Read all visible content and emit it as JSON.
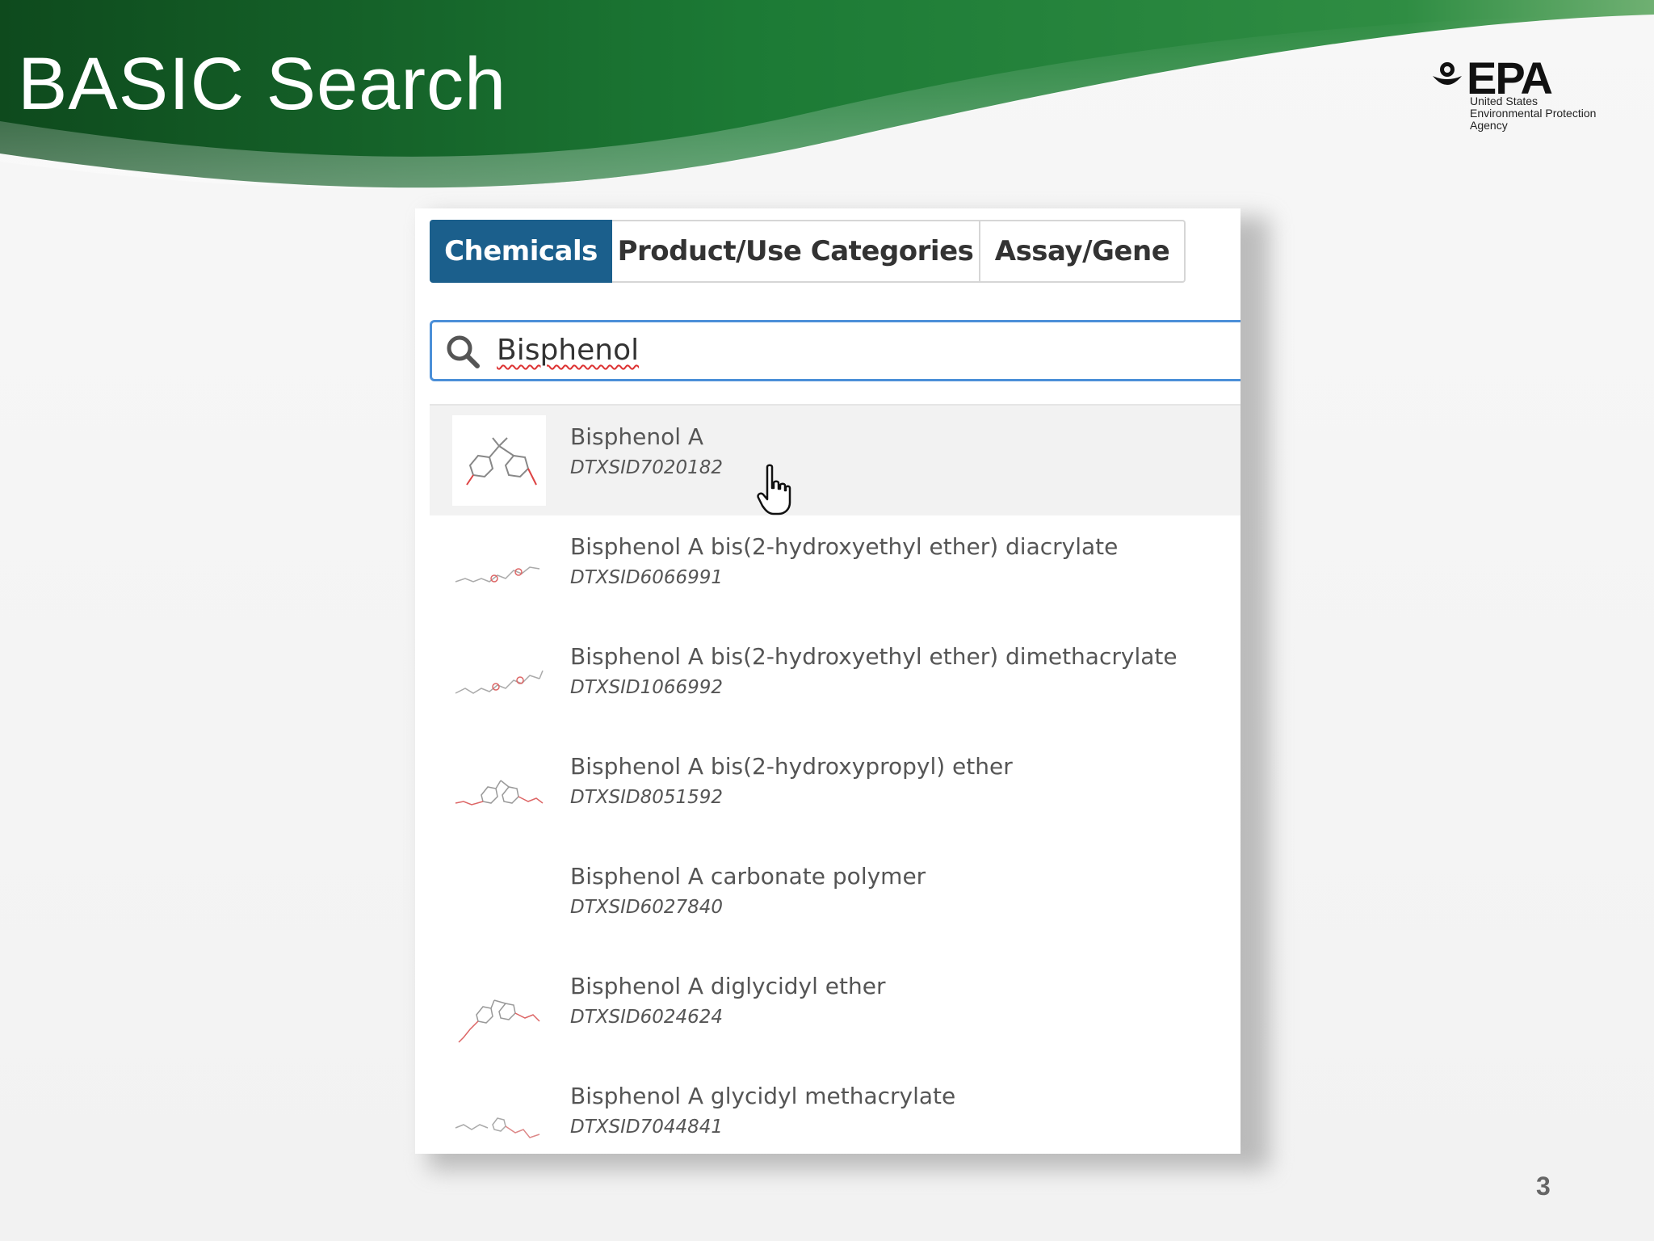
{
  "slide": {
    "title": "BASIC Search",
    "page_number": "3",
    "colors": {
      "banner_dark": "#0f4d1f",
      "banner_mid": "#1f7a36",
      "banner_light": "#5aa05f"
    }
  },
  "logo": {
    "wordmark": "EPA",
    "subtitle": "United States\nEnvironmental Protection\nAgency"
  },
  "tabs": [
    {
      "label": "Chemicals",
      "active": true
    },
    {
      "label": "Product/Use Categories",
      "active": false
    },
    {
      "label": "Assay/Gene",
      "active": false
    }
  ],
  "search": {
    "value": "Bisphenol",
    "icon": "search-icon",
    "accent": "#4b8fd8"
  },
  "results": [
    {
      "name": "Bisphenol A",
      "id": "DTXSID7020182",
      "hover": true
    },
    {
      "name": "Bisphenol A bis(2-hydroxyethyl ether) diacrylate",
      "id": "DTXSID6066991"
    },
    {
      "name": "Bisphenol A bis(2-hydroxyethyl ether) dimethacrylate",
      "id": "DTXSID1066992"
    },
    {
      "name": "Bisphenol A bis(2-hydroxypropyl) ether",
      "id": "DTXSID8051592"
    },
    {
      "name": "Bisphenol A carbonate polymer",
      "id": "DTXSID6027840"
    },
    {
      "name": "Bisphenol A diglycidyl ether",
      "id": "DTXSID6024624"
    },
    {
      "name": "Bisphenol A glycidyl methacrylate",
      "id": "DTXSID7044841"
    }
  ],
  "colors": {
    "tab_active": "#1b5f8c",
    "hover_row": "#f2f2f2"
  }
}
